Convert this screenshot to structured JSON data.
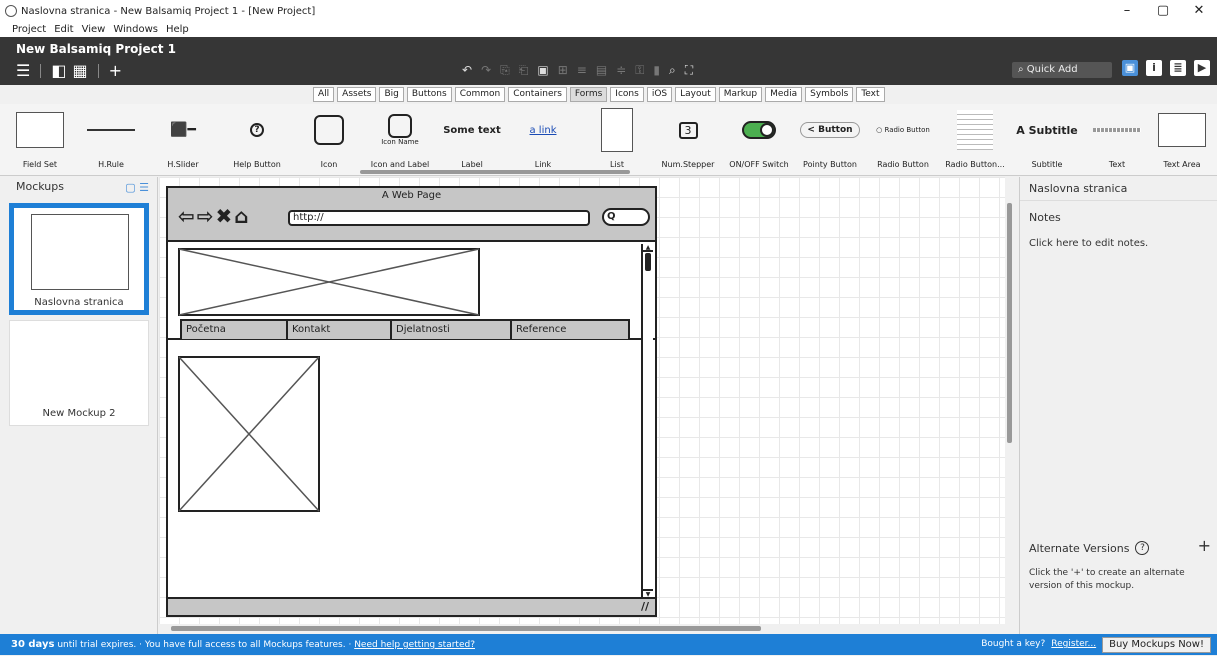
{
  "window": {
    "title": "Naslovna stranica - New Balsamiq Project 1 - [New Project]",
    "controls": [
      "–",
      "▢",
      "✕"
    ]
  },
  "menu": [
    "Project",
    "Edit",
    "View",
    "Windows",
    "Help"
  ],
  "app": {
    "project_name": "New Balsamiq Project 1",
    "quick_add_placeholder": "Quick Add"
  },
  "categories": [
    "All",
    "Assets",
    "Big",
    "Buttons",
    "Common",
    "Containers",
    "Forms",
    "Icons",
    "iOS",
    "Layout",
    "Markup",
    "Media",
    "Symbols",
    "Text"
  ],
  "active_category": "Forms",
  "library": [
    {
      "label": "Field Set",
      "glyph": ""
    },
    {
      "label": "H.Rule",
      "glyph": ""
    },
    {
      "label": "H.Slider",
      "glyph": ""
    },
    {
      "label": "Help Button",
      "glyph": "?"
    },
    {
      "label": "Icon",
      "glyph": ""
    },
    {
      "label": "Icon and Label",
      "glyph": "Icon Name"
    },
    {
      "label": "Label",
      "glyph": "Some text"
    },
    {
      "label": "Link",
      "glyph": "a link"
    },
    {
      "label": "List",
      "glyph": ""
    },
    {
      "label": "Num.Stepper",
      "glyph": "3"
    },
    {
      "label": "ON/OFF Switch",
      "glyph": ""
    },
    {
      "label": "Pointy Button",
      "glyph": "< Button"
    },
    {
      "label": "Radio Button",
      "glyph": "○ Radio Button"
    },
    {
      "label": "Radio Button...",
      "glyph": ""
    },
    {
      "label": "Subtitle",
      "glyph": "A Subtitle"
    },
    {
      "label": "Text",
      "glyph": ""
    },
    {
      "label": "Text Area",
      "glyph": ""
    }
  ],
  "mockups_panel": {
    "header": "Mockups",
    "items": [
      {
        "name": "Naslovna stranica",
        "selected": true
      },
      {
        "name": "New Mockup 2",
        "selected": false
      }
    ]
  },
  "mockup": {
    "title": "A Web Page",
    "nav_icons": "⇦⇨✖⌂",
    "url": "http://",
    "search_glyph": "Q",
    "tabs": [
      "Početna",
      "Kontakt",
      "Djelatnosti",
      "Reference"
    ],
    "resize_grip": "//"
  },
  "right_panel": {
    "title": "Naslovna stranica",
    "notes_label": "Notes",
    "notes_hint": "Click here to edit notes.",
    "alt_versions_label": "Alternate Versions",
    "alt_versions_hint": "Click the '+' to create an alternate version of this mockup.",
    "help_glyph": "?",
    "add_glyph": "+"
  },
  "status": {
    "days": "30 days",
    "trial_text": "until trial expires.",
    "sep1": "·",
    "access_text": "You have full access to all Mockups features.",
    "sep2": "·",
    "help_link": "Need help getting started?",
    "bought_text": "Bought a key?",
    "register_link": "Register...",
    "buy_button": "Buy Mockups Now!"
  }
}
